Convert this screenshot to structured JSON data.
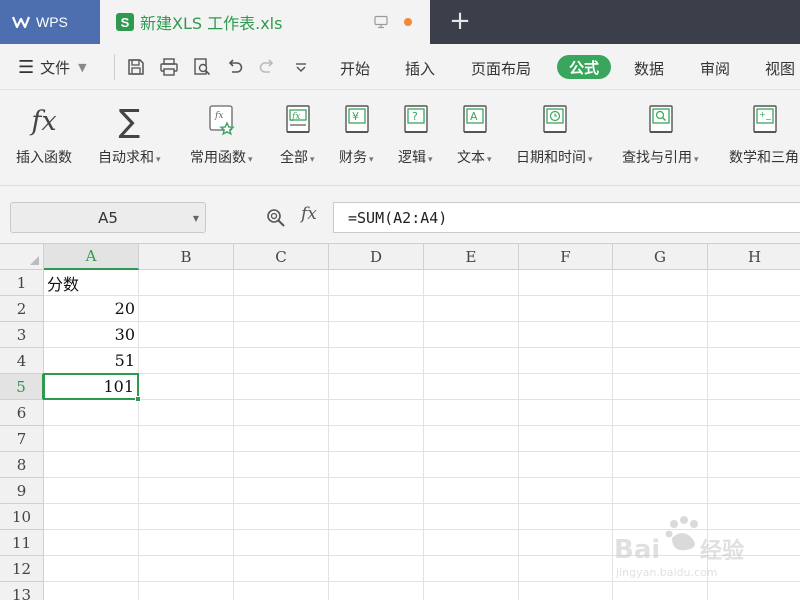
{
  "titlebar": {
    "app_tab": "WPS",
    "doc_tab": "新建XLS 工作表.xls",
    "doc_icon_letter": "S",
    "new_tab_symbol": "+"
  },
  "menubar": {
    "file_label": "文件",
    "tabs": [
      "开始",
      "插入",
      "页面布局",
      "公式",
      "数据",
      "审阅",
      "视图"
    ],
    "active_tab": "公式"
  },
  "ribbon": {
    "items": [
      {
        "label": "插入函数",
        "icon": "fx-icon"
      },
      {
        "label": "自动求和",
        "icon": "sigma-icon",
        "dropdown": true
      },
      {
        "label": "常用函数",
        "icon": "star-function-icon",
        "dropdown": true
      },
      {
        "label": "全部",
        "icon": "all-functions-icon",
        "dropdown": true
      },
      {
        "label": "财务",
        "icon": "finance-icon",
        "dropdown": true
      },
      {
        "label": "逻辑",
        "icon": "logic-icon",
        "dropdown": true
      },
      {
        "label": "文本",
        "icon": "text-icon",
        "dropdown": true
      },
      {
        "label": "日期和时间",
        "icon": "clock-icon",
        "dropdown": true
      },
      {
        "label": "查找与引用",
        "icon": "lookup-icon",
        "dropdown": true
      },
      {
        "label": "数学和三角",
        "icon": "math-icon",
        "dropdown": true
      }
    ]
  },
  "formula_bar": {
    "name_box": "A5",
    "fx_label": "fx",
    "formula": "=SUM(A2:A4)"
  },
  "sheet": {
    "columns": [
      "A",
      "B",
      "C",
      "D",
      "E",
      "F",
      "G",
      "H"
    ],
    "rows": [
      "1",
      "2",
      "3",
      "4",
      "5",
      "6",
      "7",
      "8",
      "9",
      "10",
      "11",
      "12",
      "13"
    ],
    "selected_cell": "A5",
    "cells": {
      "A1": "分数",
      "A2": "20",
      "A3": "30",
      "A4": "51",
      "A5": "101"
    }
  },
  "colors": {
    "accent": "#3aa55c",
    "selection": "#2f9a4f",
    "wps_tab": "#4d6fb0",
    "tab_bar": "#3b3f4a"
  }
}
